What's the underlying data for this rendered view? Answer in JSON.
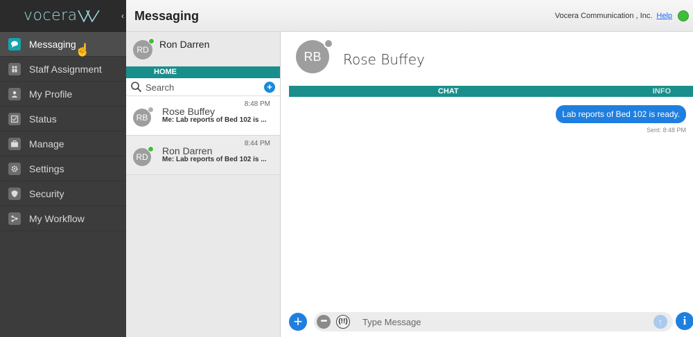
{
  "app": {
    "logo_text": "vocera",
    "brand_color": "#14a5ae"
  },
  "sidebar": {
    "items": [
      {
        "label": "Messaging",
        "icon": "chat-bubble-icon",
        "active": true
      },
      {
        "label": "Staff Assignment",
        "icon": "staff-assignment-icon",
        "active": false
      },
      {
        "label": "My Profile",
        "icon": "person-icon",
        "active": false
      },
      {
        "label": "Status",
        "icon": "status-icon",
        "active": false
      },
      {
        "label": "Manage",
        "icon": "briefcase-icon",
        "active": false
      },
      {
        "label": "Settings",
        "icon": "gear-icon",
        "active": false
      },
      {
        "label": "Security",
        "icon": "shield-icon",
        "active": false
      },
      {
        "label": "My Workflow",
        "icon": "workflow-icon",
        "active": false
      }
    ]
  },
  "header": {
    "title": "Messaging",
    "org": "Vocera Communication , Inc.",
    "help_label": "Help",
    "status_color": "#3fbd3a"
  },
  "conversations": {
    "me": {
      "initials": "RD",
      "name": "Ron Darren",
      "presence_color": "#3fbd3a"
    },
    "home_tab": "HOME",
    "search": {
      "placeholder": "Search"
    },
    "items": [
      {
        "initials": "RB",
        "name": "Rose Buffey",
        "time": "8:48 PM",
        "preview": "Me: Lab reports of Bed 102 is ...",
        "presence_color": "#b0b0b0",
        "selected": true
      },
      {
        "initials": "RD",
        "name": "Ron Darren",
        "time": "8:44 PM",
        "preview": "Me: Lab reports of Bed 102 is ...",
        "presence_color": "#3fbd3a",
        "selected": false
      }
    ]
  },
  "chat": {
    "contact": {
      "initials": "RB",
      "name": "Rose Buffey"
    },
    "tabs": {
      "chat": "CHAT",
      "info": "INFO"
    },
    "messages": [
      {
        "text": "Lab reports of Bed 102 is ready.",
        "sent": "Sent: 8:48 PM",
        "from_me": true
      }
    ],
    "compose": {
      "placeholder": "Type Message",
      "add": "+",
      "more": "•••",
      "urgent": "(!!)",
      "send": "↑",
      "info": "i"
    }
  }
}
